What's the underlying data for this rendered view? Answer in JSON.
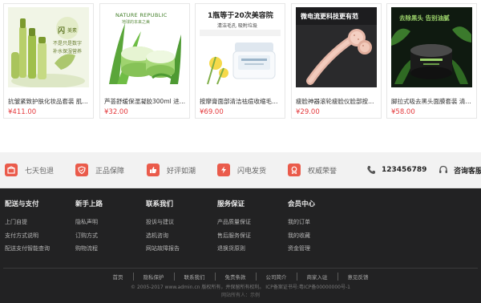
{
  "products": [
    {
      "name": "抗皱紧致护肤化妆品套装 肌初...",
      "price": "¥411.00",
      "image": {
        "kind": "green-serum-bottles",
        "lines": [
          "闪",
          "美素",
          "不是只是数字",
          "补水保湿营养"
        ]
      }
    },
    {
      "name": "芦荟舒缓保湿凝胶300ml 进口...",
      "price": "¥32.00",
      "image": {
        "kind": "aloe-gel-jars",
        "lines": [
          "NATURE REPUBLIC",
          "地球的本来之美"
        ]
      }
    },
    {
      "name": "按摩膏面部清洁祛痘收缩毛孔 ...",
      "price": "¥69.00",
      "image": {
        "kind": "cream-jar-promo",
        "lines": [
          "1瓶等于20次美容院",
          "清洁毛孔  吸附垃圾"
        ]
      }
    },
    {
      "name": "瘦脸神器滚轮瘦脸仪脸部按摩器...",
      "price": "¥29.00",
      "image": {
        "kind": "roller-massager",
        "lines": [
          "微电流更科技更有范"
        ]
      }
    },
    {
      "name": "脚拉式吸去黑头面膜套装 清洁...",
      "price": "¥58.00",
      "image": {
        "kind": "black-mask-jar",
        "lines": [
          "去除黑头  告别油腻"
        ]
      }
    }
  ],
  "services": [
    {
      "label": "七天包退",
      "icon": "return-box-icon"
    },
    {
      "label": "正品保障",
      "icon": "shield-icon"
    },
    {
      "label": "好评如潮",
      "icon": "thumbs-up-icon"
    },
    {
      "label": "闪电发货",
      "icon": "lightning-icon"
    },
    {
      "label": "权威荣誉",
      "icon": "medal-icon"
    }
  ],
  "contact": {
    "phone": "123456789",
    "service": "咨询客服"
  },
  "footer": {
    "columns": [
      {
        "title": "配送与支付",
        "links": [
          "上门自提",
          "支付方式说明",
          "配送支付智能查询"
        ]
      },
      {
        "title": "新手上路",
        "links": [
          "隐私声明",
          "订购方式",
          "购物流程"
        ]
      },
      {
        "title": "联系我们",
        "links": [
          "投诉与建议",
          "选机咨询",
          "网站故障报告"
        ]
      },
      {
        "title": "服务保证",
        "links": [
          "产品质量保证",
          "售后服务保证",
          "退换货原则"
        ]
      },
      {
        "title": "会员中心",
        "links": [
          "我的订单",
          "我的收藏",
          "资金管理"
        ]
      }
    ],
    "nav": [
      "首页",
      "隐私保护",
      "联系我们",
      "免责条款",
      "公司简介",
      "商家入驻",
      "意见反馈"
    ],
    "copyright": "© 2005-2017 www.admin.cn 版权所有，并保留所有权利。 ICP备案证书号:粤ICP备00000000号-1",
    "owner": "网站所有人：示例"
  },
  "colors": {
    "price": "#e4393c",
    "service_icon": "#ea5b4b",
    "footer_bg": "#222223",
    "service_bg": "#f2f2f2"
  }
}
